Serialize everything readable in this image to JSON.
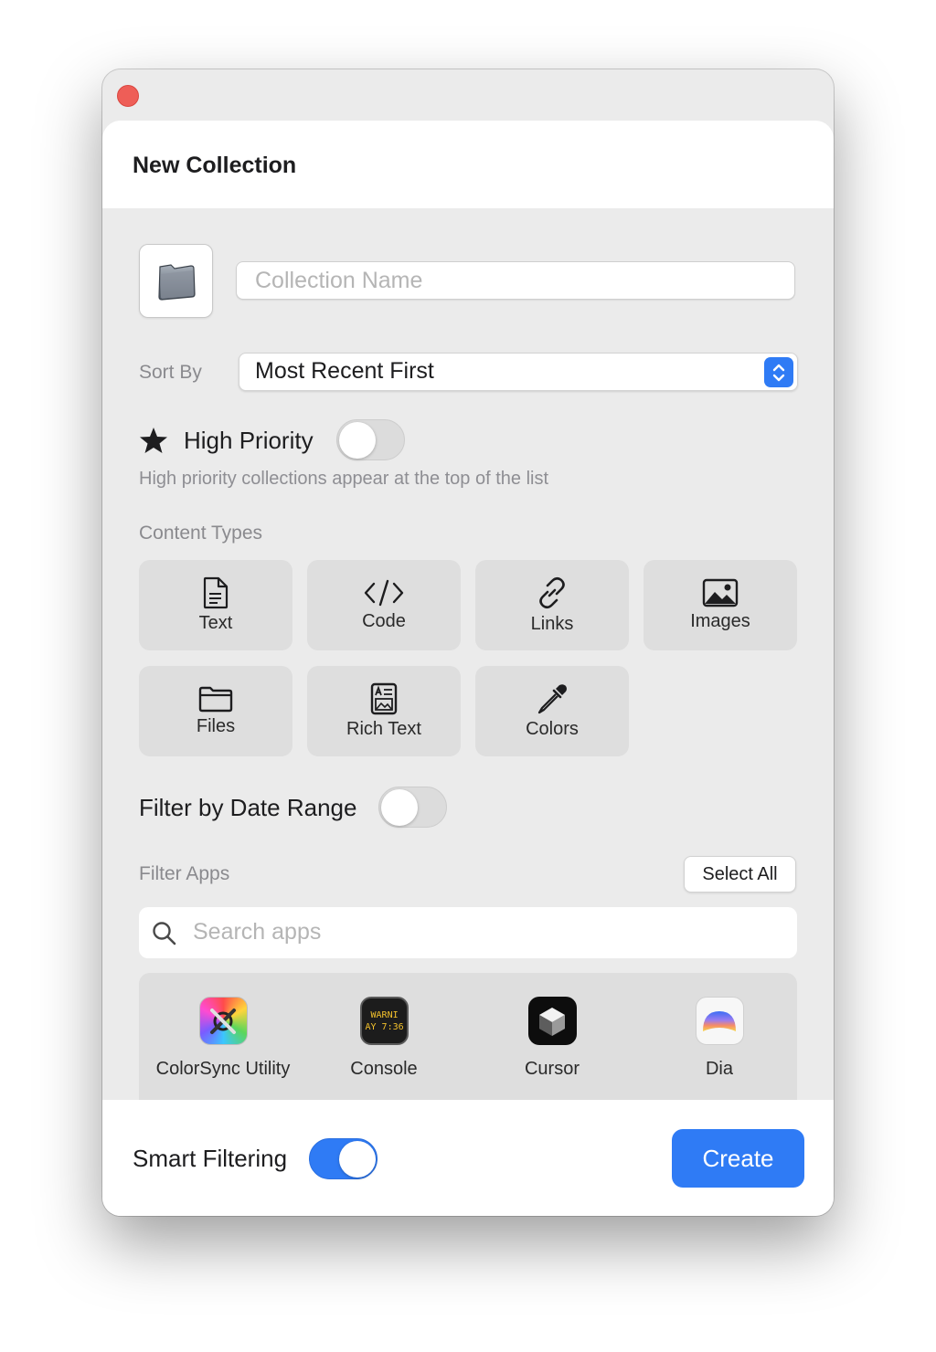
{
  "window": {
    "title": "New Collection"
  },
  "name_field": {
    "placeholder": "Collection Name",
    "value": ""
  },
  "sort": {
    "label": "Sort By",
    "value": "Most Recent First"
  },
  "priority": {
    "label": "High Priority",
    "enabled": false,
    "hint": "High priority collections appear at the top of the list"
  },
  "content_types": {
    "label": "Content Types",
    "items": [
      {
        "label": "Text",
        "icon": "document-icon"
      },
      {
        "label": "Code",
        "icon": "code-icon"
      },
      {
        "label": "Links",
        "icon": "link-icon"
      },
      {
        "label": "Images",
        "icon": "image-icon"
      },
      {
        "label": "Files",
        "icon": "folder-icon"
      },
      {
        "label": "Rich Text",
        "icon": "rich-text-icon"
      },
      {
        "label": "Colors",
        "icon": "eyedropper-icon"
      }
    ]
  },
  "date_filter": {
    "label": "Filter by Date Range",
    "enabled": false
  },
  "filter_apps": {
    "label": "Filter Apps",
    "select_all": "Select All",
    "search_placeholder": "Search apps",
    "apps": [
      {
        "name": "ColorSync Utility",
        "icon_text": ""
      },
      {
        "name": "Console",
        "icon_text": "WARNI\nAY 7:36"
      },
      {
        "name": "Cursor",
        "icon_text": ""
      },
      {
        "name": "Dia",
        "icon_text": ""
      }
    ]
  },
  "footer": {
    "smart_filtering_label": "Smart Filtering",
    "smart_filtering_enabled": true,
    "create_label": "Create"
  },
  "colors": {
    "accent": "#2f7bf5",
    "close": "#ee5e57"
  }
}
